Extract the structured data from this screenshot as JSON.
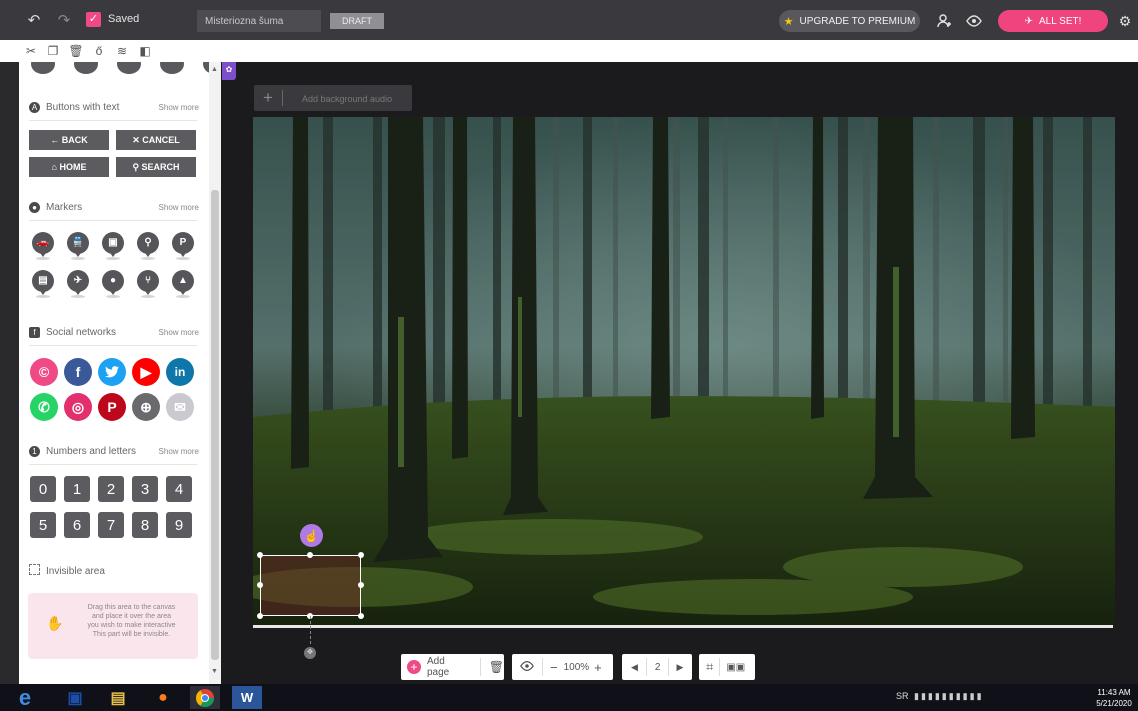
{
  "topbar": {
    "saved_label": "Saved",
    "project_title": "Misteriozna šuma",
    "draft_label": "DRAFT",
    "upgrade_label": "UPGRADE TO PREMIUM",
    "allset_label": "ALL SET!"
  },
  "sidebar": {
    "buttons_section": {
      "title": "Buttons with text",
      "more": "Show more"
    },
    "buttons": [
      {
        "label": "← BACK"
      },
      {
        "label": "✕ CANCEL"
      },
      {
        "label": "⌂ HOME"
      },
      {
        "label": "⚲ SEARCH"
      }
    ],
    "markers_section": {
      "title": "Markers",
      "more": "Show more"
    },
    "markers_row1": [
      "P"
    ],
    "social_section": {
      "title": "Social networks",
      "more": "Show more"
    },
    "numbers_section": {
      "title": "Numbers and letters",
      "more": "Show more"
    },
    "numbers": [
      "0",
      "1",
      "2",
      "3",
      "4",
      "5",
      "6",
      "7",
      "8",
      "9"
    ],
    "invisible_section": {
      "title": "Invisible area"
    },
    "invisible_help": [
      "Drag this area to the canvas",
      "and place it over the area",
      "you wish to make interactive",
      "This part will be invisible."
    ]
  },
  "stage": {
    "audio_label": "Add background audio"
  },
  "bottombar": {
    "add_page_label": "Add page",
    "zoom_label": "100%",
    "page_number": "2"
  },
  "taskbar": {
    "tray_lang": "SR",
    "time": "11:43 AM",
    "date": "5/21/2020"
  },
  "colors": {
    "accent_pink": "#f0447f",
    "dark_bar": "#3a3a3e",
    "button_gray": "#5b5b60"
  }
}
